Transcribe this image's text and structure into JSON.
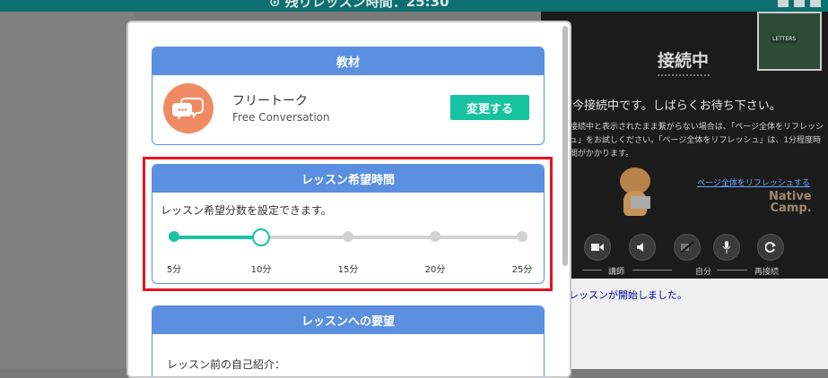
{
  "topbar": {
    "timer_text": "⊙ 残りレッスン時間：25:30"
  },
  "video": {
    "thumbnail_label": "LETTERS",
    "status_title": "接続中",
    "status_message": "ご今接続中です。しばらくお待ち下さい。",
    "note": "接続中と表示されたまま繋がらない場合は、「ページ全体をリフレッシュ」をお試しください。「ページ全体をリフレッシュ」は、1分程度時間がかかります。",
    "refresh_link": "ページ全体をリフレッシュする",
    "brand_line1": "Native",
    "brand_line2": "Camp.",
    "labels": {
      "teacher": "講師",
      "self": "自分",
      "reconnect": "再接続"
    }
  },
  "chat": {
    "message": "レッスンが開始しました。"
  },
  "modal": {
    "material": {
      "header": "教材",
      "title": "フリートーク",
      "subtitle": "Free Conversation",
      "change_button": "変更する",
      "icon": "chat-bubbles-icon"
    },
    "duration": {
      "header": "レッスン希望時間",
      "description": "レッスン希望分数を設定できます。",
      "options": [
        "5分",
        "10分",
        "15分",
        "20分",
        "25分"
      ],
      "selected_index": 1
    },
    "request": {
      "header": "レッスンへの要望",
      "intro_label": "レッスン前の自己紹介："
    }
  },
  "colors": {
    "header_blue": "#5b8fe0",
    "accent_teal": "#17c2a0",
    "highlight_red": "#e5141f",
    "icon_orange": "#f08a62"
  }
}
